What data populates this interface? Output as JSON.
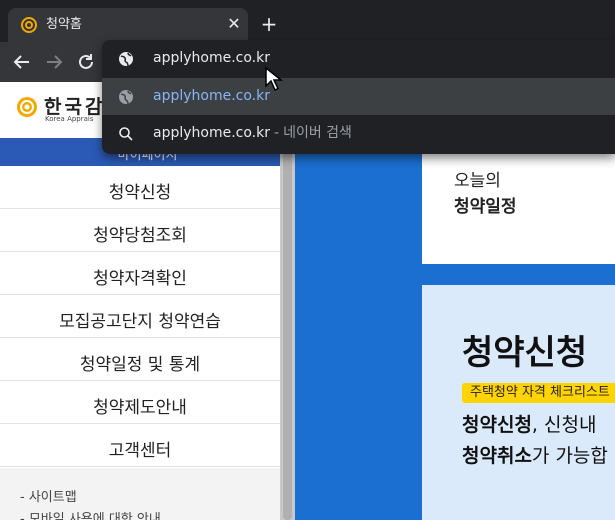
{
  "browser": {
    "tab": {
      "title": "청약홈",
      "favicon": "applyhome-favicon",
      "close_glyph": "✕"
    },
    "new_tab_glyph": "+",
    "toolbar": {
      "back_icon": "arrow-left-icon",
      "forward_icon": "arrow-right-icon",
      "reload_icon": "reload-icon"
    },
    "omnibox": {
      "rows": [
        {
          "icon": "globe-icon",
          "text": "applyhome.co.kr"
        },
        {
          "icon": "globe-icon",
          "text": "applyhome.co.kr"
        },
        {
          "icon": "search-icon",
          "text": "applyhome.co.kr",
          "separator": "-",
          "suffix": "네이버 검색"
        }
      ]
    }
  },
  "page": {
    "header": {
      "logo_ko": "한국감",
      "logo_en": "Korea Apprais"
    },
    "mypage_label": "⌃ 마이페이지",
    "menu": [
      {
        "label": "청약신청"
      },
      {
        "label": "청약당첨조회"
      },
      {
        "label": "청약자격확인"
      },
      {
        "label": "모집공고단지 청약연습"
      },
      {
        "label": "청약일정 및 통계"
      },
      {
        "label": "청약제도안내"
      },
      {
        "label": "고객센터"
      }
    ],
    "footer_links": [
      "- 사이트맵",
      "- 모바일 사용에 대한 안내"
    ],
    "schedule_card": {
      "line1": "오늘의",
      "line2": "청약일정"
    },
    "apply_card": {
      "title": "청약신청",
      "badge": "주택청약 자격 체크리스트",
      "line1_bold": "청약신청",
      "line1_rest": ", 신청내",
      "line2_bold": "청약취소",
      "line2_rest": "가 가능합"
    }
  },
  "colors": {
    "chrome_dark": "#202124",
    "toolbar": "#35363a",
    "link_blue": "#8ab4f8",
    "nav_blue": "#2a5ab5",
    "content_blue": "#1a6fd0",
    "card_light_blue": "#dbeafb",
    "badge_yellow": "#ffd400",
    "logo_gold": "#f2a900"
  }
}
